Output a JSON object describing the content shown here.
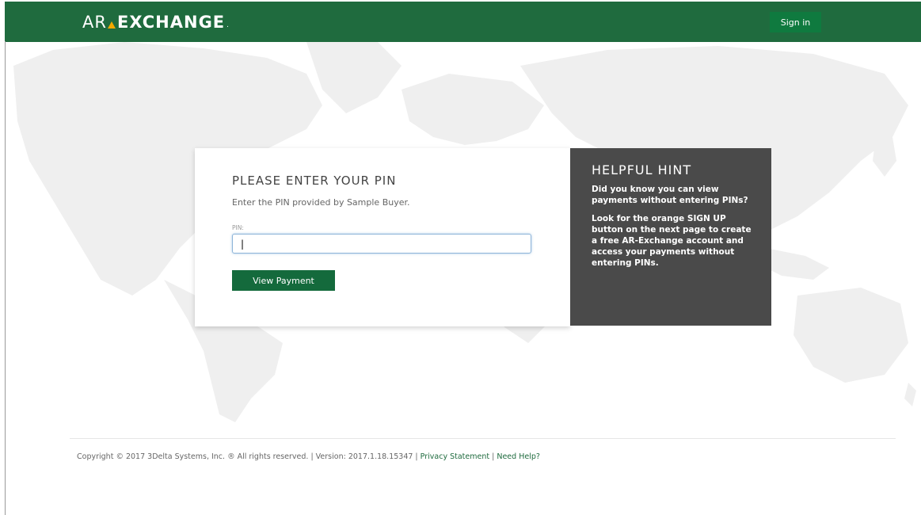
{
  "header": {
    "logo_ar": "AR",
    "logo_exchange": "EXCHANGE",
    "logo_reg": ".",
    "signin_label": "Sign in"
  },
  "pin_card": {
    "title": "PLEASE ENTER YOUR PIN",
    "subtitle": "Enter the PIN provided by Sample Buyer.",
    "pin_label": "PIN:",
    "pin_value": "|",
    "button_label": "View Payment"
  },
  "hint": {
    "title": "HELPFUL HINT",
    "paragraph_1": "Did you know you can view payments without entering PINs?",
    "paragraph_2": "Look for the orange SIGN UP button on the next page to create a free AR-Exchange account and access your payments without entering PINs."
  },
  "footer": {
    "copyright": "Copyright © 2017 3Delta Systems, Inc. ® All rights reserved. | Version: 2017.1.18.15347 |",
    "privacy_link": "Privacy Statement",
    "separator": "|",
    "help_link": "Need Help?"
  },
  "colors": {
    "brand_green": "#1f6b3e",
    "accent_orange": "#f2a900",
    "hint_bg": "#4a4a4a"
  }
}
